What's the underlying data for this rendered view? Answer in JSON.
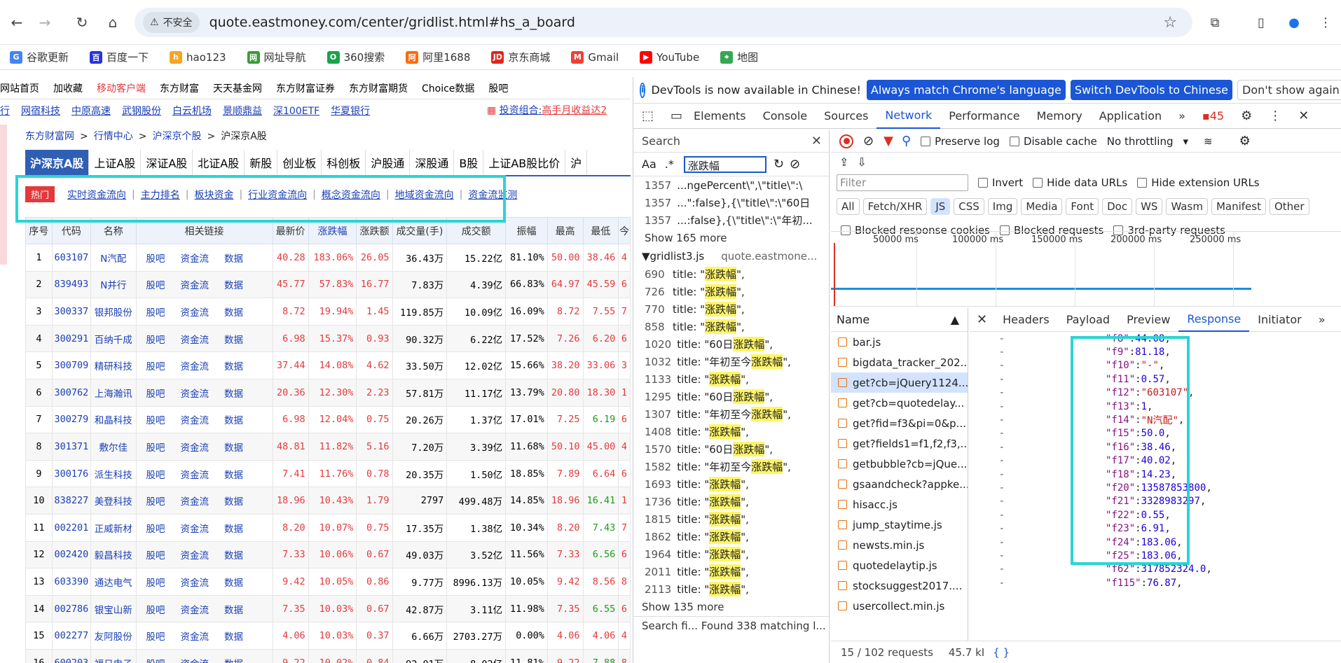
{
  "browser": {
    "insecure_label": "不安全",
    "url": "quote.eastmoney.com/center/gridlist.html#hs_a_board",
    "bookmarks": [
      {
        "label": "谷歌更新",
        "color": "#4285f4",
        "glyph": "G"
      },
      {
        "label": "百度一下",
        "color": "#2932e1",
        "glyph": "百"
      },
      {
        "label": "hao123",
        "color": "#f5a623",
        "glyph": "h"
      },
      {
        "label": "网址导航",
        "color": "#3a9b3a",
        "glyph": "网"
      },
      {
        "label": "360搜索",
        "color": "#1aa34a",
        "glyph": "O"
      },
      {
        "label": "阿里1688",
        "color": "#ff6a00",
        "glyph": "阿"
      },
      {
        "label": "京东商城",
        "color": "#e1251b",
        "glyph": "JD"
      },
      {
        "label": "Gmail",
        "color": "#ea4335",
        "glyph": "M"
      },
      {
        "label": "YouTube",
        "color": "#ff0000",
        "glyph": "▶"
      },
      {
        "label": "地图",
        "color": "#34a853",
        "glyph": "⌖"
      }
    ]
  },
  "page": {
    "topnav": [
      "网站首页",
      "加收藏",
      "移动客户端",
      "东方财富",
      "天天基金网",
      "东方财富证券",
      "东方财富期货",
      "Choice数据",
      "股吧"
    ],
    "stock_links": [
      "行",
      "网宿科技",
      "中原高速",
      "武钢股份",
      "白云机场",
      "景顺鼎益",
      "深100ETF",
      "华夏银行"
    ],
    "promo_label": "投资组合:",
    "promo_link": "高手月收益达2",
    "breadcrumb": [
      "东方财富网",
      "行情中心",
      "沪深京个股",
      "沪深京A股"
    ],
    "breadcrumb_sep": ">",
    "tabs": [
      "沪深京A股",
      "上证A股",
      "深证A股",
      "北证A股",
      "新股",
      "创业板",
      "科创板",
      "沪股通",
      "深股通",
      "B股",
      "上证AB股比价",
      "沪"
    ],
    "hot_label": "热门",
    "subnav": [
      "实时资金流向",
      "主力排名",
      "板块资金",
      "行业资金流向",
      "概念资金流向",
      "地域资金流向",
      "资金流监测"
    ],
    "table": {
      "headers": [
        "序号",
        "代码",
        "名称",
        "相关链接",
        "最新价",
        "涨跌幅",
        "涨跌额",
        "成交量(手)",
        "成交额",
        "振幅",
        "最高",
        "最低",
        "今"
      ],
      "link_labels": [
        "股吧",
        "资金流",
        "数据"
      ],
      "rows": [
        {
          "no": "1",
          "code": "603107",
          "name": "N汽配",
          "price": "40.28",
          "pct": "183.06%",
          "chg": "26.05",
          "vol": "36.43万",
          "amt": "15.22亿",
          "amp": "81.10%",
          "high": "50.00",
          "low": "38.46",
          "open": "4"
        },
        {
          "no": "2",
          "code": "839493",
          "name": "N并行",
          "price": "45.77",
          "pct": "57.83%",
          "chg": "16.77",
          "vol": "7.83万",
          "amt": "4.39亿",
          "amp": "66.83%",
          "high": "64.97",
          "low": "45.59",
          "open": "6"
        },
        {
          "no": "3",
          "code": "300337",
          "name": "银邦股份",
          "price": "8.72",
          "pct": "19.94%",
          "chg": "1.45",
          "vol": "119.85万",
          "amt": "10.09亿",
          "amp": "16.09%",
          "high": "8.72",
          "low": "7.55",
          "open": "7"
        },
        {
          "no": "4",
          "code": "300291",
          "name": "百纳千成",
          "price": "6.98",
          "pct": "15.37%",
          "chg": "0.93",
          "vol": "90.32万",
          "amt": "6.22亿",
          "amp": "17.52%",
          "high": "7.26",
          "low": "6.20",
          "open": "6"
        },
        {
          "no": "5",
          "code": "300709",
          "name": "精研科技",
          "price": "37.44",
          "pct": "14.08%",
          "chg": "4.62",
          "vol": "33.50万",
          "amt": "12.02亿",
          "amp": "15.66%",
          "high": "38.20",
          "low": "33.06",
          "open": "3"
        },
        {
          "no": "6",
          "code": "300762",
          "name": "上海瀚讯",
          "price": "20.36",
          "pct": "12.30%",
          "chg": "2.23",
          "vol": "57.81万",
          "amt": "11.17亿",
          "amp": "13.79%",
          "high": "20.80",
          "low": "18.30",
          "open": "1"
        },
        {
          "no": "7",
          "code": "300279",
          "name": "和晶科技",
          "price": "6.98",
          "pct": "12.04%",
          "chg": "0.75",
          "vol": "20.26万",
          "amt": "1.37亿",
          "amp": "17.01%",
          "high": "7.25",
          "low": "6.19",
          "open": "6"
        },
        {
          "no": "8",
          "code": "301371",
          "name": "敷尔佳",
          "price": "48.81",
          "pct": "11.82%",
          "chg": "5.16",
          "vol": "7.20万",
          "amt": "3.39亿",
          "amp": "11.68%",
          "high": "50.10",
          "low": "45.00",
          "open": "4"
        },
        {
          "no": "9",
          "code": "300176",
          "name": "派生科技",
          "price": "7.41",
          "pct": "11.76%",
          "chg": "0.78",
          "vol": "20.35万",
          "amt": "1.50亿",
          "amp": "18.85%",
          "high": "7.89",
          "low": "6.64",
          "open": "6"
        },
        {
          "no": "10",
          "code": "838227",
          "name": "美登科技",
          "price": "18.96",
          "pct": "10.43%",
          "chg": "1.79",
          "vol": "2797",
          "amt": "499.48万",
          "amp": "14.85%",
          "high": "18.96",
          "low": "16.41",
          "open": "1"
        },
        {
          "no": "11",
          "code": "002201",
          "name": "正威新材",
          "price": "8.20",
          "pct": "10.07%",
          "chg": "0.75",
          "vol": "17.35万",
          "amt": "1.38亿",
          "amp": "10.34%",
          "high": "8.20",
          "low": "7.43",
          "open": "7"
        },
        {
          "no": "12",
          "code": "002420",
          "name": "毅昌科技",
          "price": "7.33",
          "pct": "10.06%",
          "chg": "0.67",
          "vol": "49.03万",
          "amt": "3.52亿",
          "amp": "11.56%",
          "high": "7.33",
          "low": "6.56",
          "open": "6"
        },
        {
          "no": "13",
          "code": "603390",
          "name": "通达电气",
          "price": "9.42",
          "pct": "10.05%",
          "chg": "0.86",
          "vol": "9.77万",
          "amt": "8996.13万",
          "amp": "10.05%",
          "high": "9.42",
          "low": "8.56",
          "open": "8"
        },
        {
          "no": "14",
          "code": "002786",
          "name": "银宝山新",
          "price": "7.35",
          "pct": "10.03%",
          "chg": "0.67",
          "vol": "42.87万",
          "amt": "3.11亿",
          "amp": "11.98%",
          "high": "7.35",
          "low": "6.55",
          "open": "6"
        },
        {
          "no": "15",
          "code": "002277",
          "name": "友阿股份",
          "price": "4.06",
          "pct": "10.03%",
          "chg": "0.37",
          "vol": "6.66万",
          "amt": "2703.27万",
          "amp": "0.00%",
          "high": "4.06",
          "low": "4.06",
          "open": "4"
        },
        {
          "no": "16",
          "code": "600203",
          "name": "福日电子",
          "price": "9.22",
          "pct": "10.02%",
          "chg": "0.84",
          "vol": "92.01万",
          "amt": "8.02亿",
          "amp": "11.81%",
          "high": "9.22",
          "low": "7.88",
          "open": "8"
        }
      ]
    }
  },
  "devtools": {
    "info_message": "DevTools is now available in Chinese!",
    "btn_match": "Always match Chrome's language",
    "btn_switch": "Switch DevTools to Chinese",
    "btn_dismiss": "Don't show again",
    "tabs": [
      "Elements",
      "Console",
      "Sources",
      "Network",
      "Performance",
      "Memory",
      "Application"
    ],
    "issues_count": "45",
    "search": {
      "title": "Search",
      "aa": "Aa",
      "regex": ".*",
      "query": "涨跌幅",
      "top_lines": [
        {
          "ln": "1357",
          "text": "...ngePercent\\\",\\\"title\\\":\\"
        },
        {
          "ln": "1357",
          "text": "...\":false},{\\\"title\\\":\\\"60日"
        },
        {
          "ln": "1357",
          "text": "...:false},{\\\"title\\\":\\\"年初..."
        }
      ],
      "show_more_1": "Show 165 more",
      "file_name": "▼gridlist3.js",
      "file_origin": "quote.eastmone...",
      "results": [
        {
          "ln": "690",
          "pre": "title: \"",
          "hit": "涨跌幅",
          "post": "\","
        },
        {
          "ln": "726",
          "pre": "title: \"",
          "hit": "涨跌幅",
          "post": "\","
        },
        {
          "ln": "770",
          "pre": "title: \"",
          "hit": "涨跌幅",
          "post": "\","
        },
        {
          "ln": "858",
          "pre": "title: \"",
          "hit": "涨跌幅",
          "post": "\","
        },
        {
          "ln": "1020",
          "pre": "title: \"60日",
          "hit": "涨跌幅",
          "post": "\","
        },
        {
          "ln": "1032",
          "pre": "title: \"年初至今",
          "hit": "涨跌幅",
          "post": "\","
        },
        {
          "ln": "1133",
          "pre": "title: \"",
          "hit": "涨跌幅",
          "post": "\","
        },
        {
          "ln": "1295",
          "pre": "title: \"60日",
          "hit": "涨跌幅",
          "post": "\","
        },
        {
          "ln": "1307",
          "pre": "title: \"年初至今",
          "hit": "涨跌幅",
          "post": "\","
        },
        {
          "ln": "1408",
          "pre": "title: \"",
          "hit": "涨跌幅",
          "post": "\","
        },
        {
          "ln": "1570",
          "pre": "title: \"60日",
          "hit": "涨跌幅",
          "post": "\","
        },
        {
          "ln": "1582",
          "pre": "title: \"年初至今",
          "hit": "涨跌幅",
          "post": "\","
        },
        {
          "ln": "1693",
          "pre": "title: \"",
          "hit": "涨跌幅",
          "post": "\","
        },
        {
          "ln": "1736",
          "pre": "title: \"",
          "hit": "涨跌幅",
          "post": "\","
        },
        {
          "ln": "1815",
          "pre": "title: \"",
          "hit": "涨跌幅",
          "post": "\","
        },
        {
          "ln": "1862",
          "pre": "title: \"",
          "hit": "涨跌幅",
          "post": "\","
        },
        {
          "ln": "1964",
          "pre": "title: \"",
          "hit": "涨跌幅",
          "post": "\","
        },
        {
          "ln": "2011",
          "pre": "title: \"",
          "hit": "涨跌幅",
          "post": "\","
        },
        {
          "ln": "2113",
          "pre": "title: \"",
          "hit": "涨跌幅",
          "post": "\","
        }
      ],
      "show_more_2": "Show 135 more",
      "footer": "Search fi...  Found 338 matching l..."
    },
    "network": {
      "preserve_log": "Preserve log",
      "disable_cache": "Disable cache",
      "throttling": "No throttling",
      "filter_placeholder": "Filter",
      "invert": "Invert",
      "hide_data_urls": "Hide data URLs",
      "hide_ext_urls": "Hide extension URLs",
      "chips": [
        "All",
        "Fetch/XHR",
        "JS",
        "CSS",
        "Img",
        "Media",
        "Font",
        "Doc",
        "WS",
        "Wasm",
        "Manifest",
        "Other"
      ],
      "selected_chip": "JS",
      "blocked_cookies": "Blocked response cookies",
      "blocked_requests": "Blocked requests",
      "third_party": "3rd-party requests",
      "timeline_labels": [
        "50000 ms",
        "100000 ms",
        "150000 ms",
        "200000 ms",
        "250000 ms"
      ],
      "name_header": "Name",
      "requests": [
        "bar.js",
        "bigdata_tracker_202...",
        "get?cb=jQuery1124...",
        "get?cb=quotedelay...",
        "get?fid=f3&pi=0&p...",
        "get?fields1=f1,f2,f3,...",
        "getbubble?cb=jQue...",
        "gsaandcheck?appke...",
        "hisacc.js",
        "jump_staytime.js",
        "newsts.min.js",
        "quotedelaytip.js",
        "stocksuggest2017....",
        "usercollect.min.js"
      ],
      "selected_request_index": 2,
      "status_requests": "15 / 102 requests",
      "status_size": "45.7 kI",
      "detail_tabs": [
        "Headers",
        "Payload",
        "Preview",
        "Response",
        "Initiator"
      ],
      "active_detail_tab": "Response",
      "response_lines": [
        {
          "k": "\"f8\"",
          "v": "44.08",
          "t": "num"
        },
        {
          "k": "\"f9\"",
          "v": "81.18",
          "t": "num"
        },
        {
          "k": "\"f10\"",
          "v": "\"-\"",
          "t": "str"
        },
        {
          "k": "\"f11\"",
          "v": "0.57",
          "t": "num"
        },
        {
          "k": "\"f12\"",
          "v": "\"603107\"",
          "t": "str"
        },
        {
          "k": "\"f13\"",
          "v": "1",
          "t": "num"
        },
        {
          "k": "\"f14\"",
          "v": "\"N汽配\"",
          "t": "str"
        },
        {
          "k": "\"f15\"",
          "v": "50.0",
          "t": "num"
        },
        {
          "k": "\"f16\"",
          "v": "38.46",
          "t": "num"
        },
        {
          "k": "\"f17\"",
          "v": "40.02",
          "t": "num"
        },
        {
          "k": "\"f18\"",
          "v": "14.23",
          "t": "num"
        },
        {
          "k": "\"f20\"",
          "v": "13587853800",
          "t": "num"
        },
        {
          "k": "\"f21\"",
          "v": "3328983297",
          "t": "num"
        },
        {
          "k": "\"f22\"",
          "v": "0.55",
          "t": "num"
        },
        {
          "k": "\"f23\"",
          "v": "6.91",
          "t": "num"
        },
        {
          "k": "\"f24\"",
          "v": "183.06",
          "t": "num"
        },
        {
          "k": "\"f25\"",
          "v": "183.06",
          "t": "num"
        },
        {
          "k": "\"f62\"",
          "v": "317852324.0",
          "t": "num"
        },
        {
          "k": "\"f115\"",
          "v": "76.87",
          "t": "num"
        }
      ]
    }
  },
  "colors": {
    "highlight": "#2bd4d4",
    "accent": "#1a56d6",
    "up": "#e4393c",
    "down": "#1b9c1b"
  }
}
